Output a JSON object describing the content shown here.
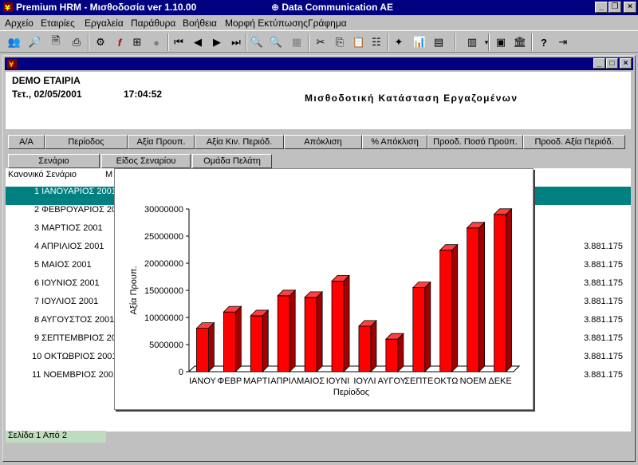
{
  "window": {
    "title": "Premium HRM  -  Μισθοδοσία ver 1.10.00",
    "center_title": "Data Communication AE"
  },
  "menu": [
    "Αρχείο",
    "Εταιρίες",
    "Εργαλεία",
    "Παράθυρα",
    "Βοήθεια",
    "Μορφή Εκτύπωσης",
    "Γράφημα"
  ],
  "report": {
    "company": "DEMO ΕΤΑΙΡΙΑ",
    "date": "Τετ., 02/05/2001",
    "time": "17:04:52",
    "title": "Μισθοδοτική Κατάσταση Εργαζομένων"
  },
  "columns": [
    "Α/Α",
    "Περίοδος",
    "Αξία Προυπ.",
    "Αξία Κιν. Περιόδ.",
    "Απόκλιση",
    "% Απόκλιση",
    "Προοδ. Ποσό Προϋπ.",
    "Προοδ. Αξία Περιόδ."
  ],
  "group_buttons": [
    "Σενάριο",
    "Είδος Σεναρίου",
    "Ομάδα Πελάτη"
  ],
  "grid": {
    "subheader": "Κανονικό Σενάριο",
    "subheader_right": "Μ",
    "rows": [
      {
        "label": "1  ΙΑΝΟΥΑΡΙΟΣ 2001",
        "value": ""
      },
      {
        "label": "2  ΦΕΒΡΟΥΑΡΙΟΣ 2001",
        "value": ""
      },
      {
        "label": "3  ΜΑΡΤΙΟΣ 2001",
        "value": ""
      },
      {
        "label": "4  ΑΠΡΙΛΙΟΣ 2001",
        "value": "3.881.175"
      },
      {
        "label": "5  ΜΑΙΟΣ 2001",
        "value": "3.881.175"
      },
      {
        "label": "6  ΙΟΥΝΙΟΣ 2001",
        "value": "3.881.175"
      },
      {
        "label": "7  ΙΟΥΛΙΟΣ 2001",
        "value": "3.881.175"
      },
      {
        "label": "8  ΑΥΓΟΥΣΤΟΣ 2001",
        "value": "3.881.175"
      },
      {
        "label": "9  ΣΕΠΤΕΜΒΡΙΟΣ 2001",
        "value": "3.881.175"
      },
      {
        "label": "10  ΟΚΤΩΒΡΙΟΣ 2001",
        "value": "3.881.175"
      },
      {
        "label": "11  ΝΟΕΜΒΡΙΟΣ 2001",
        "value": "3.881.175"
      }
    ]
  },
  "page_indicator": "Σελίδα 1 Από 2",
  "chart_data": {
    "type": "bar",
    "categories": [
      "ΙΑΝΟΥ",
      "ΦΕΒΡ",
      "ΜΑΡΤΙ",
      "ΑΠΡΙΛ",
      "ΜΑΙΟΣ",
      "ΙΟΥΝΙ",
      "ΙΟΥΛΙ",
      "ΑΥΓΟΥ",
      "ΣΕΠΤΕ",
      "ΟΚΤΩ",
      "ΝΟΕΜ",
      "ΔΕΚΕ"
    ],
    "values": [
      8000000,
      11000000,
      10300000,
      14000000,
      13700000,
      16700000,
      8400000,
      6000000,
      15500000,
      22400000,
      26500000,
      29000000
    ],
    "ylabel": "Αξία Προυπ.",
    "xlabel": "Περίοδος",
    "ylim": [
      0,
      30000000
    ],
    "yticks": [
      "0",
      "5000000",
      "10000000",
      "15000000",
      "20000000",
      "25000000",
      "30000000"
    ],
    "bar_color": "#ff0000",
    "grid": false
  }
}
